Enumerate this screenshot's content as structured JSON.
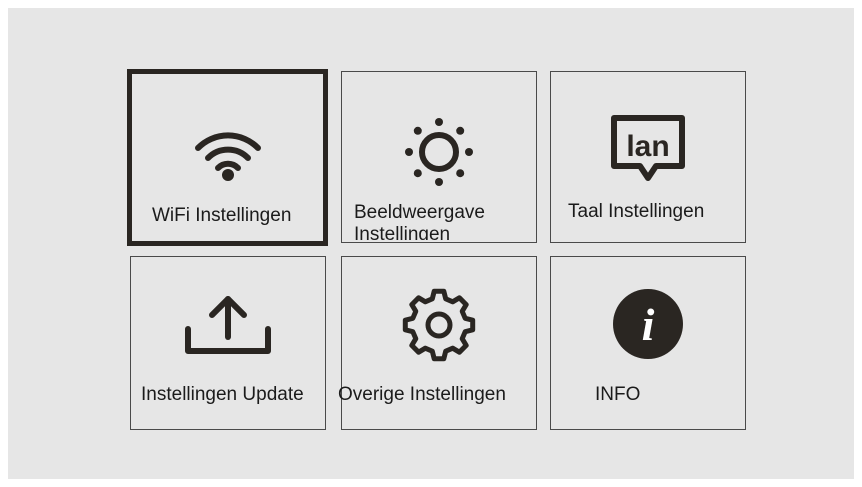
{
  "colors": {
    "screen_background": "#e6e6e6",
    "tile_border": "#4a4a4a",
    "selected_border": "#2a2622",
    "icon": "#2a2622",
    "text": "#1b1b1b"
  },
  "menu": {
    "selected_index": 0,
    "tiles": [
      {
        "label": "WiFi Instellingen",
        "icon": "wifi-icon"
      },
      {
        "label": "Beeldweergave Instellingen",
        "icon": "brightness-icon"
      },
      {
        "label": "Taal Instellingen",
        "icon": "language-icon",
        "icon_text": "lan"
      },
      {
        "label": "Instellingen Update",
        "icon": "upload-icon"
      },
      {
        "label": "Overige Instellingen",
        "icon": "gear-icon"
      },
      {
        "label": "INFO",
        "icon": "info-icon",
        "icon_text": "i"
      }
    ]
  }
}
